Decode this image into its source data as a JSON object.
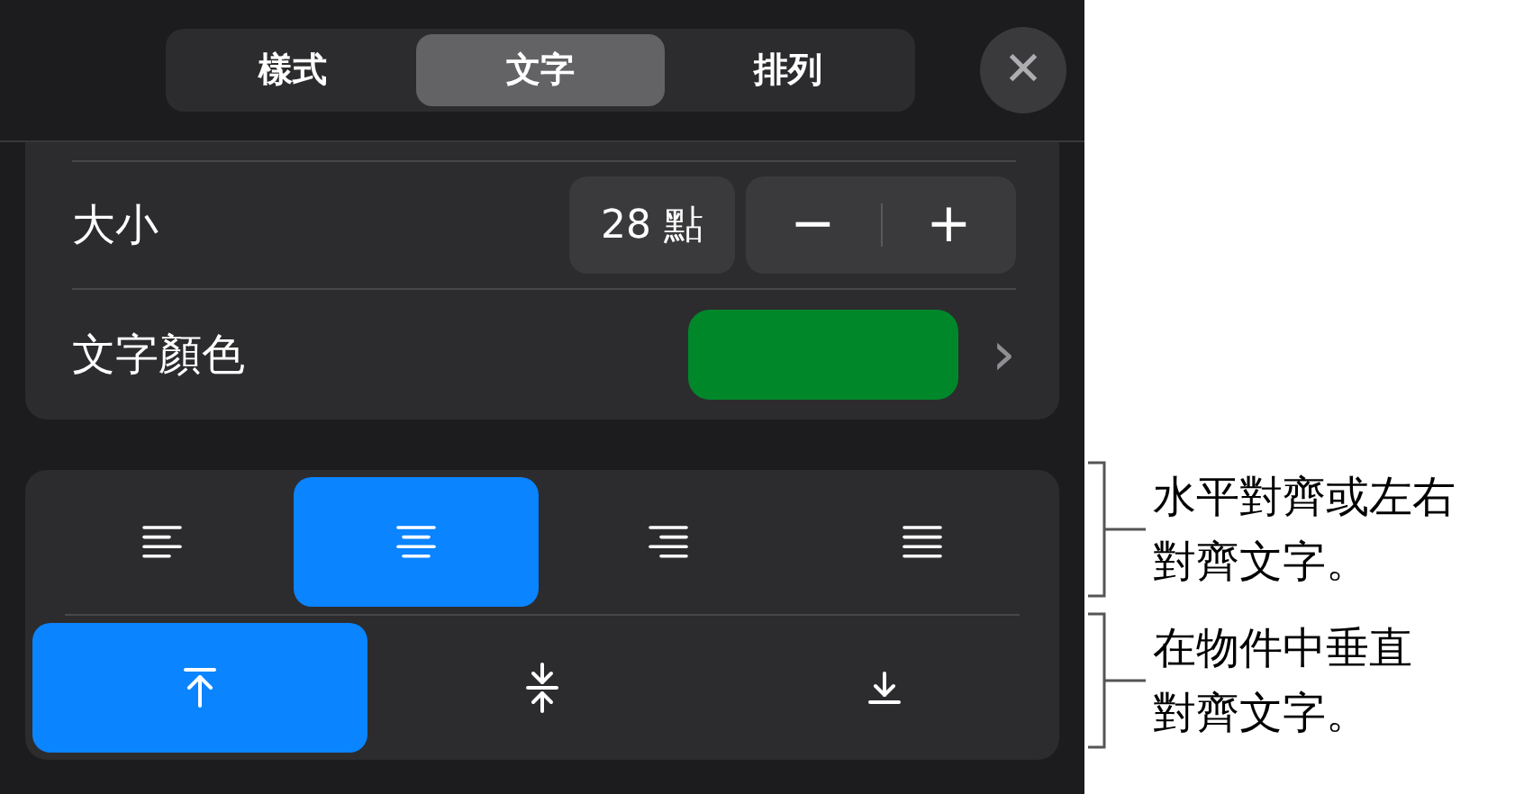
{
  "tabs": [
    {
      "label": "樣式",
      "selected": false
    },
    {
      "label": "文字",
      "selected": true
    },
    {
      "label": "排列",
      "selected": false
    }
  ],
  "close_button": {
    "label": "✕"
  },
  "font_size": {
    "label": "大小",
    "value": "28 點",
    "decrement": "−",
    "increment": "+"
  },
  "text_color": {
    "label": "文字顏色",
    "color": "#00872a",
    "chevron": "›"
  },
  "horizontal_alignment": [
    {
      "kind": "left",
      "selected": false
    },
    {
      "kind": "center",
      "selected": true
    },
    {
      "kind": "right",
      "selected": false
    },
    {
      "kind": "justify",
      "selected": false
    }
  ],
  "vertical_alignment": [
    {
      "kind": "top",
      "selected": true
    },
    {
      "kind": "middle",
      "selected": false
    },
    {
      "kind": "bottom",
      "selected": false
    }
  ],
  "callouts": [
    {
      "lines": [
        "水平對齊或左右",
        "對齊文字。"
      ]
    },
    {
      "lines": [
        "在物件中垂直",
        "對齊文字。"
      ]
    }
  ]
}
